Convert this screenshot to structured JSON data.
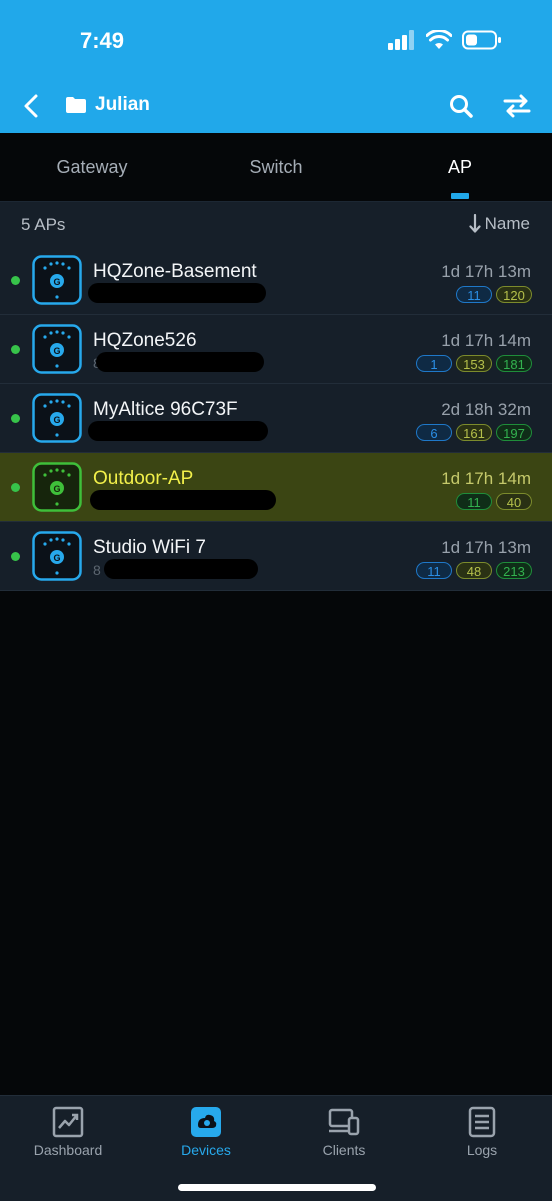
{
  "status_bar": {
    "time": "7:49"
  },
  "header": {
    "title": "Julian"
  },
  "tabs": [
    {
      "label": "Gateway",
      "active": false
    },
    {
      "label": "Switch",
      "active": false
    },
    {
      "label": "AP",
      "active": true
    }
  ],
  "list_header": {
    "count": "5 APs",
    "sort_label": "Name"
  },
  "devices": [
    {
      "name": "HQZone-Basement",
      "sub": "",
      "uptime": "1d 17h 13m",
      "badges": [
        "11",
        "120"
      ],
      "status": "online"
    },
    {
      "name": "HQZone526",
      "sub": "8",
      "uptime": "1d 17h 14m",
      "badges": [
        "1",
        "153",
        "181"
      ],
      "status": "online"
    },
    {
      "name": "MyAltice 96C73F",
      "sub": "",
      "uptime": "2d 18h 32m",
      "badges": [
        "6",
        "161",
        "197"
      ],
      "status": "online"
    },
    {
      "name": "Outdoor-AP",
      "sub": "",
      "uptime": "1d 17h 14m",
      "badges": [
        "11",
        "40"
      ],
      "status": "online"
    },
    {
      "name": "Studio WiFi 7",
      "sub": "8",
      "uptime": "1d 17h 13m",
      "badges": [
        "11",
        "48",
        "213"
      ],
      "status": "online"
    }
  ],
  "bottom_nav": [
    {
      "label": "Dashboard",
      "icon": "chart-icon",
      "active": false
    },
    {
      "label": "Devices",
      "icon": "devices-icon",
      "active": true
    },
    {
      "label": "Clients",
      "icon": "clients-icon",
      "active": false
    },
    {
      "label": "Logs",
      "icon": "logs-icon",
      "active": false
    }
  ],
  "colors": {
    "accent": "#21a8ea",
    "online": "#37c34a",
    "highlight": "#f2f04a"
  }
}
